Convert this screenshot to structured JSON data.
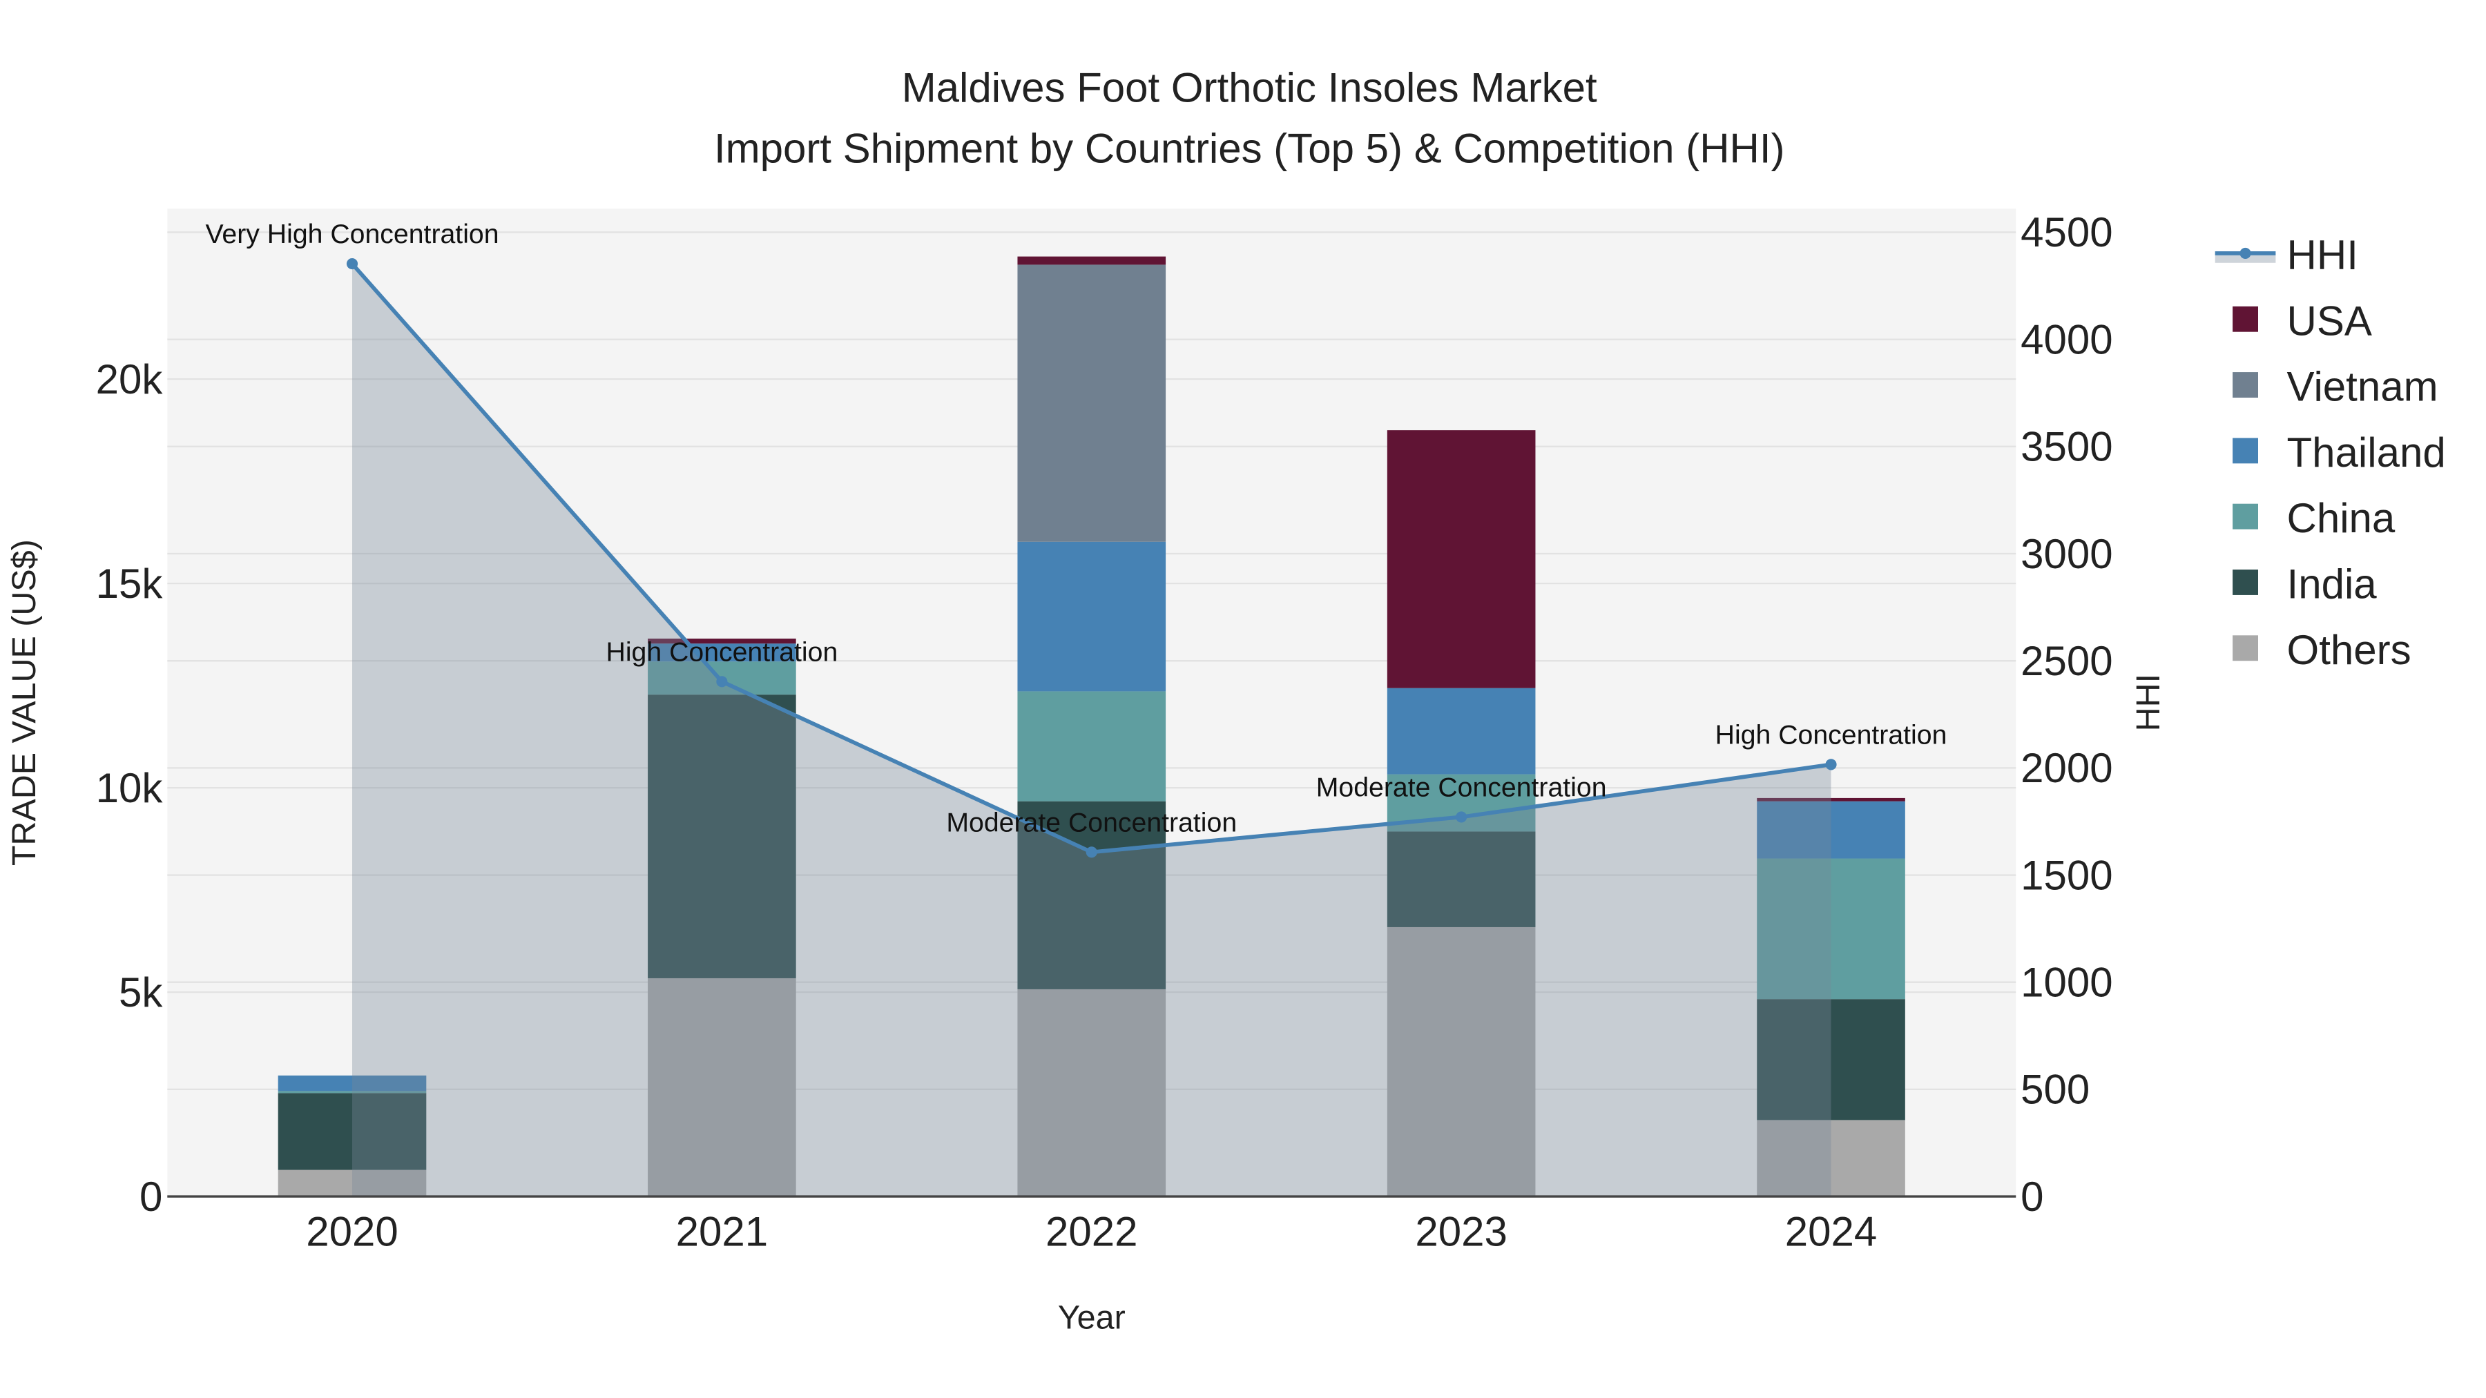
{
  "chart_data": {
    "type": "bar",
    "stacked": true,
    "title": "Maldives Foot Orthotic Insoles Market",
    "subtitle": "Import Shipment by Countries (Top 5) & Competition (HHI)",
    "xlabel": "Year",
    "ylabel": "TRADE VALUE (US$)",
    "y2label": "HHI",
    "categories": [
      "2020",
      "2021",
      "2022",
      "2023",
      "2024"
    ],
    "ylim": [
      0,
      24170
    ],
    "y2lim": [
      0,
      4610
    ],
    "yticks": [
      {
        "v": 0,
        "label": "0"
      },
      {
        "v": 5000,
        "label": "5k"
      },
      {
        "v": 10000,
        "label": "10k"
      },
      {
        "v": 15000,
        "label": "15k"
      },
      {
        "v": 20000,
        "label": "20k"
      }
    ],
    "y2ticks": [
      {
        "v": 0,
        "label": "0"
      },
      {
        "v": 500,
        "label": "500"
      },
      {
        "v": 1000,
        "label": "1000"
      },
      {
        "v": 1500,
        "label": "1500"
      },
      {
        "v": 2000,
        "label": "2000"
      },
      {
        "v": 2500,
        "label": "2500"
      },
      {
        "v": 3000,
        "label": "3000"
      },
      {
        "v": 3500,
        "label": "3500"
      },
      {
        "v": 4000,
        "label": "4000"
      },
      {
        "v": 4500,
        "label": "4500"
      }
    ],
    "series": [
      {
        "name": "Others",
        "color": "#a9a9a9",
        "values": [
          650,
          5340,
          5070,
          6590,
          1870
        ]
      },
      {
        "name": "India",
        "color": "#2f4f4f",
        "values": [
          1880,
          6940,
          4600,
          2340,
          2960
        ]
      },
      {
        "name": "China",
        "color": "#5f9ea0",
        "values": [
          50,
          810,
          2690,
          1400,
          3440
        ]
      },
      {
        "name": "Thailand",
        "color": "#4682b4",
        "values": [
          380,
          440,
          3660,
          2110,
          1400
        ]
      },
      {
        "name": "Vietnam",
        "color": "#708090",
        "values": [
          0,
          0,
          6780,
          0,
          0
        ]
      },
      {
        "name": "USA",
        "color": "#601434",
        "values": [
          0,
          120,
          200,
          6310,
          80
        ]
      }
    ],
    "hhi": {
      "name": "HHI",
      "color": "#4682b4",
      "values": [
        4353,
        2403,
        1607,
        1771,
        2016
      ],
      "annotations": [
        "Very High Concentration",
        "High Concentration",
        "Moderate Concentration",
        "Moderate Concentration",
        "High Concentration"
      ]
    },
    "legend_order": [
      "HHI",
      "USA",
      "Vietnam",
      "Thailand",
      "China",
      "India",
      "Others"
    ],
    "legend_placement": "top-right, outside",
    "grid": true
  }
}
